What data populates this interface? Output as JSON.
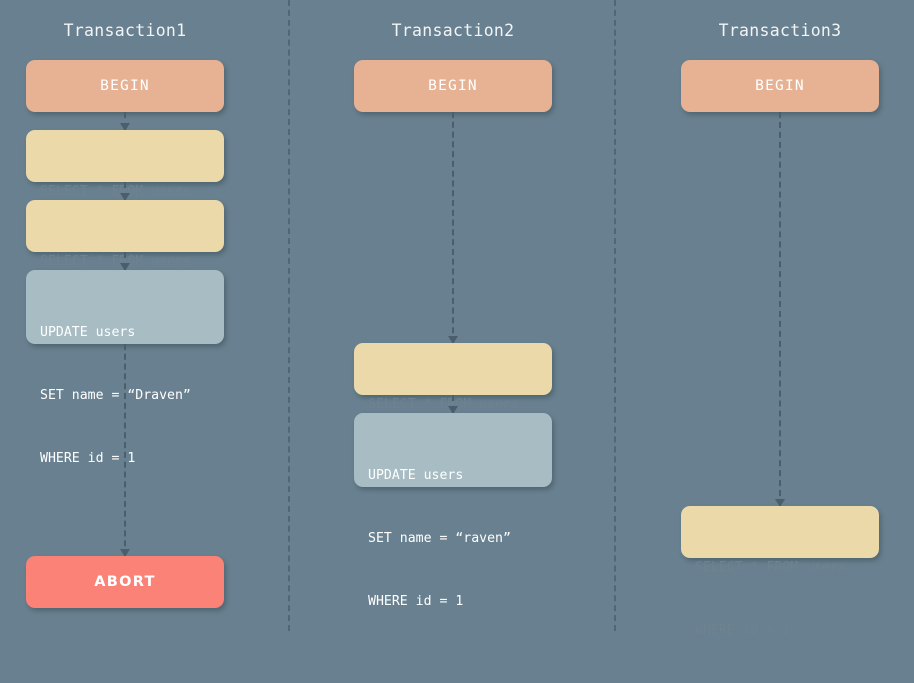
{
  "diagram": {
    "title": "Database transaction timeline diagram",
    "background_color": "#68808f",
    "colors": {
      "background": "#68808f",
      "begin_box": "#e7b193",
      "select_box": "#ebd9a9",
      "update_box": "#a8bcc4",
      "abort_box": "#fb8276",
      "separator": "#4e6370",
      "connector": "#4a5e6b",
      "title_text": "#f2f4f5",
      "select_text": "#6e8290",
      "light_text": "#ffffff"
    }
  },
  "columns": [
    {
      "id": "transaction1",
      "title": "Transaction1",
      "nodes": [
        {
          "id": "t1-begin",
          "kind": "begin",
          "lines": [
            "BEGIN"
          ]
        },
        {
          "id": "t1-select-1",
          "kind": "select",
          "lines": [
            "SELECT * FROM users",
            "WHERE id = 1"
          ]
        },
        {
          "id": "t1-select-2",
          "kind": "select",
          "lines": [
            "SELECT * FROM users",
            "WHERE id = 2"
          ]
        },
        {
          "id": "t1-update",
          "kind": "update",
          "lines": [
            "UPDATE users",
            "SET name = “Draven”",
            "WHERE id = 1"
          ]
        },
        {
          "id": "t1-abort",
          "kind": "abort",
          "lines": [
            "ABORT"
          ]
        }
      ]
    },
    {
      "id": "transaction2",
      "title": "Transaction2",
      "nodes": [
        {
          "id": "t2-begin",
          "kind": "begin",
          "lines": [
            "BEGIN"
          ]
        },
        {
          "id": "t2-select-1",
          "kind": "select",
          "lines": [
            "SELECT * FROM users",
            "WHERE id = 1"
          ]
        },
        {
          "id": "t2-update",
          "kind": "update",
          "lines": [
            "UPDATE users",
            "SET name = “raven”",
            "WHERE id = 1"
          ]
        }
      ]
    },
    {
      "id": "transaction3",
      "title": "Transaction3",
      "nodes": [
        {
          "id": "t3-begin",
          "kind": "begin",
          "lines": [
            "BEGIN"
          ]
        },
        {
          "id": "t3-select-1",
          "kind": "select",
          "lines": [
            "SELECT * FROM users",
            "WHERE id = 1"
          ]
        }
      ]
    }
  ]
}
